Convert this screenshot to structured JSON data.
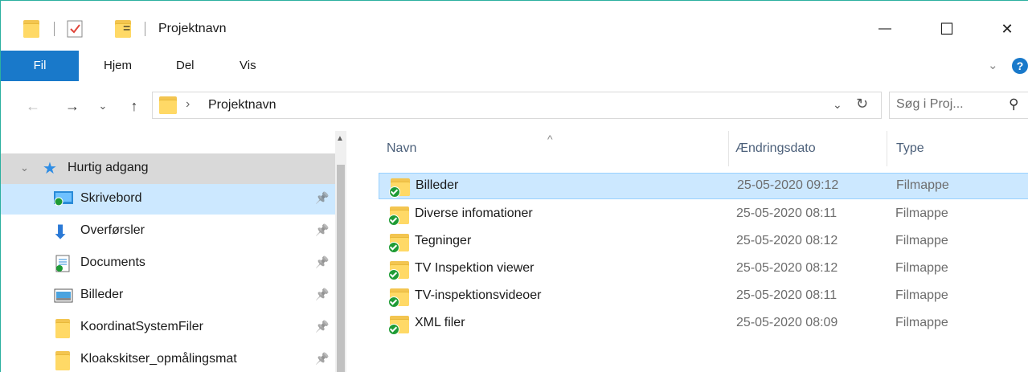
{
  "window": {
    "title": "Projektnavn",
    "qat_dropdown": "=",
    "minimize_glyph": "—",
    "maximize_glyph": "☐",
    "close_glyph": "✕"
  },
  "ribbon": {
    "tabs": [
      {
        "label": "Fil",
        "active": true
      },
      {
        "label": "Hjem"
      },
      {
        "label": "Del"
      },
      {
        "label": "Vis"
      }
    ],
    "collapse_glyph": "⌄",
    "help_glyph": "?"
  },
  "nav": {
    "back_glyph": "←",
    "forward_glyph": "→",
    "recent_glyph": "⌄",
    "up_glyph": "↑",
    "address": {
      "separator": "›",
      "crumb": "Projektnavn",
      "dropdown_glyph": "⌄",
      "refresh_glyph": "↻"
    },
    "search": {
      "placeholder": "Søg i Proj...",
      "icon_glyph": "⚲"
    }
  },
  "sidebar": {
    "section": {
      "label": "Hurtig adgang",
      "expand_glyph": "⌄"
    },
    "items": [
      {
        "label": "Skrivebord",
        "icon": "desktop-icon",
        "pinned": true
      },
      {
        "label": "Overførsler",
        "icon": "downloads-icon",
        "pinned": true
      },
      {
        "label": "Documents",
        "icon": "documents-icon",
        "pinned": true
      },
      {
        "label": "Billeder",
        "icon": "pictures-icon",
        "pinned": true
      },
      {
        "label": "KoordinatSystemFiler",
        "icon": "folder-icon",
        "pinned": true
      },
      {
        "label": "Kloakskitser_opmålingsmat",
        "icon": "folder-icon",
        "pinned": true
      }
    ],
    "pin_glyph": "📌"
  },
  "filelist": {
    "sort_glyph": "^",
    "columns": {
      "name": "Navn",
      "date": "Ændringsdato",
      "type": "Type"
    },
    "rows": [
      {
        "name": "Billeder",
        "date": "25-05-2020 09:12",
        "type": "Filmappe",
        "selected": true
      },
      {
        "name": "Diverse infomationer",
        "date": "25-05-2020 08:11",
        "type": "Filmappe"
      },
      {
        "name": "Tegninger",
        "date": "25-05-2020 08:12",
        "type": "Filmappe"
      },
      {
        "name": "TV Inspektion viewer",
        "date": "25-05-2020 08:12",
        "type": "Filmappe"
      },
      {
        "name": "TV-inspektionsvideoer",
        "date": "25-05-2020 08:11",
        "type": "Filmappe"
      },
      {
        "name": "XML filer",
        "date": "25-05-2020 08:09",
        "type": "Filmappe"
      }
    ]
  },
  "colors": {
    "accent": "#1979ca",
    "selection": "#cce8ff",
    "sync_green": "#1e9b35",
    "folder": "#ffd966"
  }
}
